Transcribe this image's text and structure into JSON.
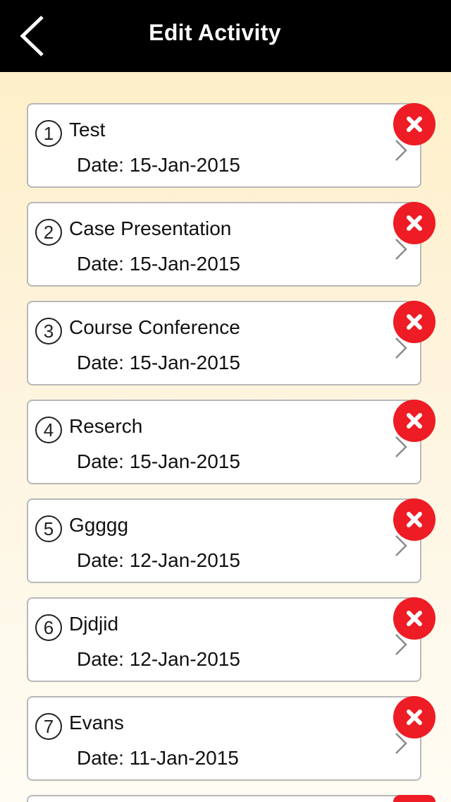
{
  "header": {
    "title": "Edit Activity",
    "back_icon": "chevron-left-icon"
  },
  "activities": [
    {
      "number": "1",
      "title": "Test",
      "date": "Date: 15-Jan-2015"
    },
    {
      "number": "2",
      "title": "Case Presentation",
      "date": "Date: 15-Jan-2015"
    },
    {
      "number": "3",
      "title": "Course Conference",
      "date": "Date: 15-Jan-2015"
    },
    {
      "number": "4",
      "title": "Reserch",
      "date": "Date: 15-Jan-2015"
    },
    {
      "number": "5",
      "title": "Ggggg",
      "date": "Date: 12-Jan-2015"
    },
    {
      "number": "6",
      "title": "Djdjid",
      "date": "Date: 12-Jan-2015"
    },
    {
      "number": "7",
      "title": "Evans",
      "date": "Date: 11-Jan-2015"
    }
  ],
  "colors": {
    "navbar": "#000000",
    "delete": "#ee1c24",
    "background_top": "#fdeec3",
    "background_bottom": "#fffcf4"
  }
}
